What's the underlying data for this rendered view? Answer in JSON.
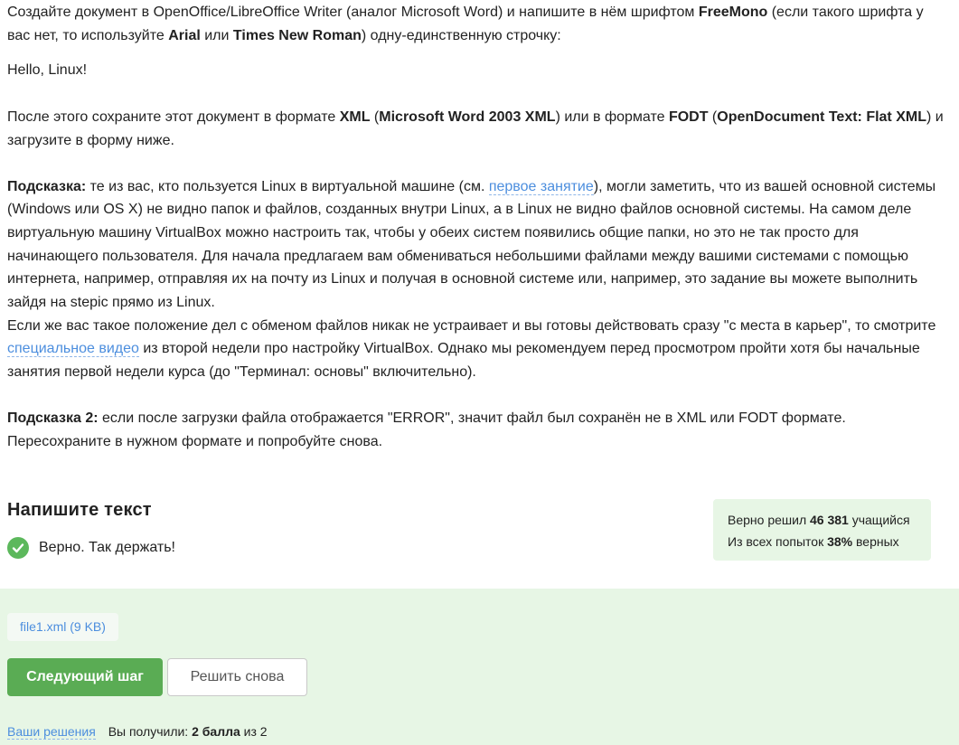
{
  "task": {
    "p1": {
      "t1": "Создайте документ в OpenOffice/LibreOffice Writer (аналог Microsoft Word) и напишите в нём шрифтом ",
      "b1": "FreeMono",
      "t2": " (если такого шрифта у вас нет, то используйте ",
      "b2": "Arial",
      "t3": " или ",
      "b3": "Times New Roman",
      "t4": ") одну-единственную строчку:"
    },
    "hello": "Hello, Linux!",
    "p2": {
      "t1": "После этого сохраните этот документ в формате ",
      "b1": "XML",
      "t2": " (",
      "b2": "Microsoft Word 2003 XML",
      "t3": ") или в формате ",
      "b3": "FODT",
      "t4": " (",
      "b4": "OpenDocument Text: Flat XML",
      "t5": ") и загрузите в форму ниже."
    },
    "hint1": {
      "label": "Подсказка:",
      "t1": " те из вас, кто пользуется Linux в виртуальной машине (см. ",
      "link": "первое занятие",
      "t2": "), могли заметить, что из вашей основной системы (Windows или OS X) не видно папок и файлов, созданных внутри Linux, а в Linux не видно файлов основной системы. На самом деле виртуальную машину VirtualBox можно настроить так, чтобы у обеих систем появились общие папки, но это не так просто для начинающего пользователя. Для начала предлагаем вам обмениваться небольшими файлами между вашими системами с помощью интернета, например, отправляя их на почту из Linux и получая в основной системе или, например, это задание вы можете выполнить зайдя на stepic прямо из Linux."
    },
    "hint1b": {
      "t1": "Если же вас такое положение дел с обменом файлов никак не устраивает и вы готовы действовать сразу \"с места в карьер\", то смотрите ",
      "link": "специальное видео",
      "t2": " из второй недели про настройку VirtualBox. Однако мы рекомендуем перед просмотром пройти хотя бы начальные занятия первой недели курса (до \"Терминал: основы\" включительно)."
    },
    "hint2": {
      "label": "Подсказка 2:",
      "t1": " если после загрузки файла отображается \"ERROR\", значит файл был сохранён не в XML или FODT формате. Пересохраните в нужном формате и попробуйте снова."
    }
  },
  "quiz": {
    "title": "Напишите текст",
    "result": "Верно. Так держать!",
    "stats": {
      "solved_prefix": "Верно решил ",
      "solved_count": "46 381",
      "solved_suffix": " учащийся",
      "attempts_prefix": "Из всех попыток ",
      "attempts_percent": "38%",
      "attempts_suffix": " верных"
    }
  },
  "submission": {
    "file": "file1.xml (9 KB)",
    "next_button": "Следующий шаг",
    "retry_button": "Решить снова",
    "solutions_link": "Ваши решения",
    "score_prefix": "Вы получили: ",
    "score_value": "2 балла",
    "score_suffix": " из 2"
  },
  "colors": {
    "accent_green": "#5aac54",
    "panel_green": "#e7f6e5",
    "link_blue": "#4c8ede",
    "check_green": "#5cb85c"
  },
  "icons": {
    "result": "check-circle-icon"
  }
}
